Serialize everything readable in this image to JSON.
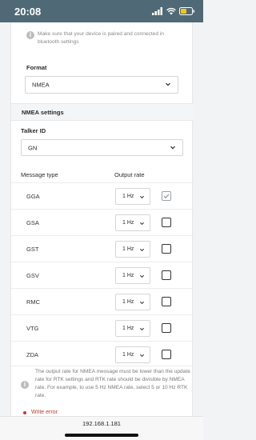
{
  "status_bar": {
    "time": "20:08",
    "icons": [
      "signal-icon",
      "wifi-icon",
      "battery-icon"
    ],
    "battery_color": "#f5c518"
  },
  "bluetooth_hint": "Make sure that your device is paired and connected in bluetooth settings",
  "format": {
    "label": "Format",
    "value": "NMEA"
  },
  "nmea_settings": {
    "title": "NMEA settings",
    "talker_id_label": "Talker ID",
    "talker_id_value": "GN",
    "message_type_header": "Message type",
    "output_rate_header": "Output rate",
    "messages": [
      {
        "name": "GGA",
        "rate": "1 Hz",
        "checked": true
      },
      {
        "name": "GSA",
        "rate": "1 Hz",
        "checked": false
      },
      {
        "name": "GST",
        "rate": "1 Hz",
        "checked": false
      },
      {
        "name": "GSV",
        "rate": "1 Hz",
        "checked": false
      },
      {
        "name": "RMC",
        "rate": "1 Hz",
        "checked": false
      },
      {
        "name": "VTG",
        "rate": "1 Hz",
        "checked": false
      },
      {
        "name": "ZDA",
        "rate": "1 Hz",
        "checked": false
      }
    ],
    "rate_note": "The output rate for NMEA message must be lower than the update rate for RTK settings and RTK rate should be divisible by NMEA rate. For example, to use 5 Hz NMEA rate, select 5 or 10 Hz RTK rate."
  },
  "error": {
    "text": "Write error",
    "color": "#c0392b"
  },
  "url_bar": {
    "url": "192.168.1.181"
  }
}
